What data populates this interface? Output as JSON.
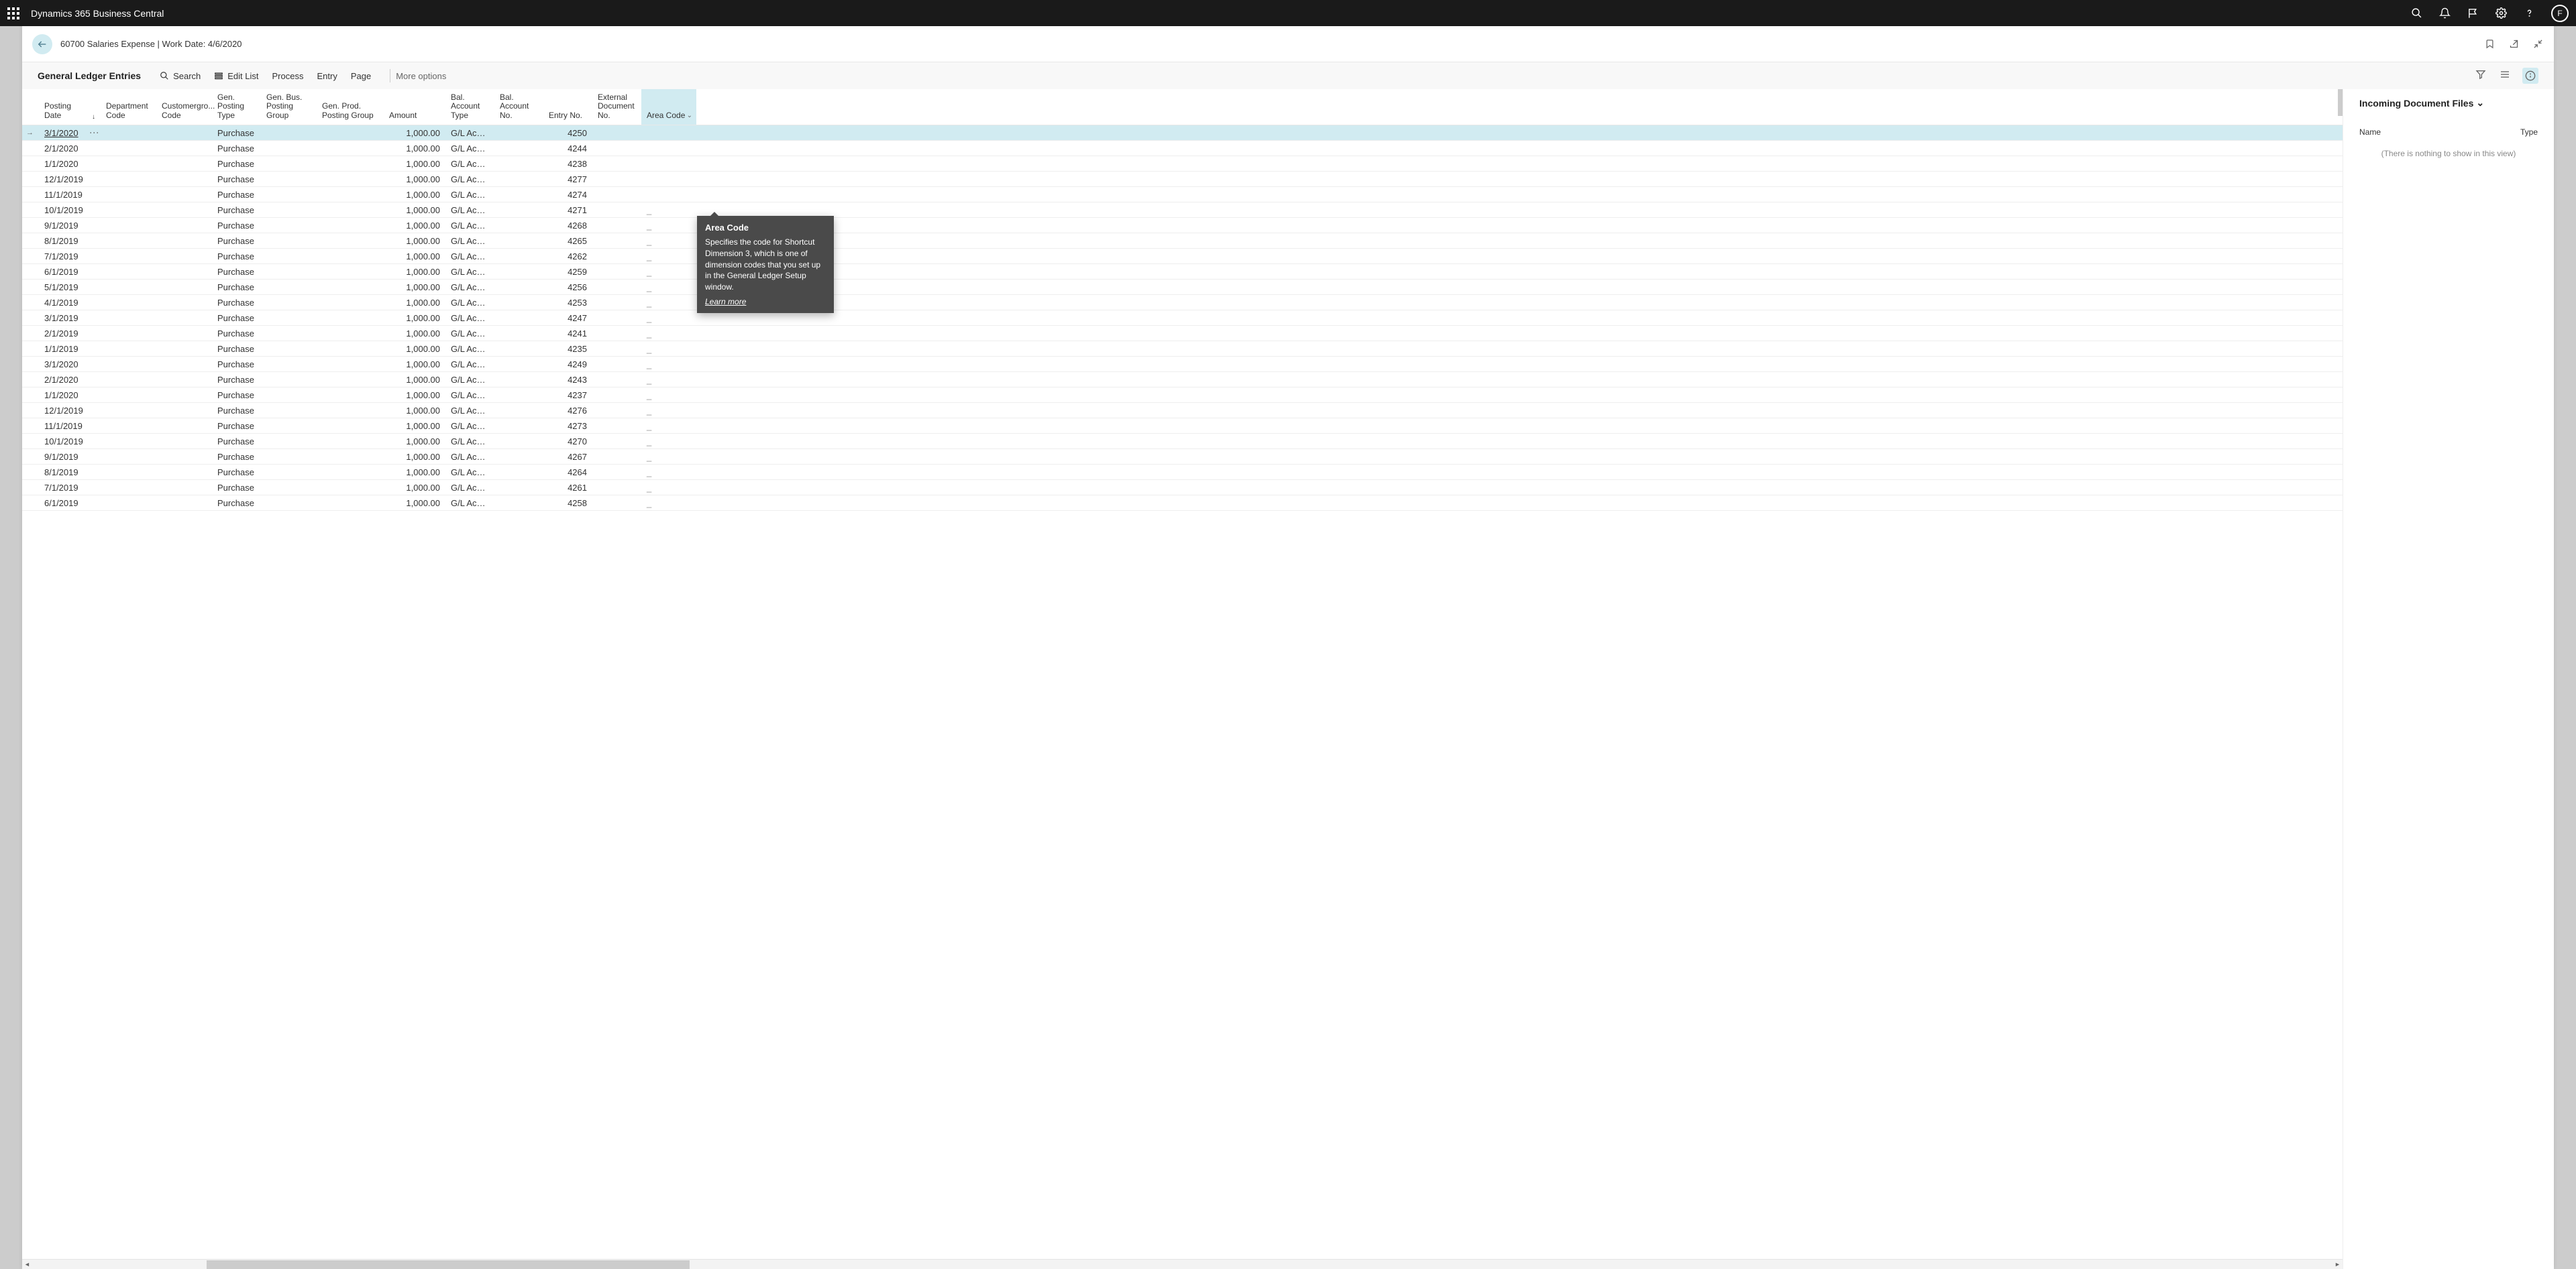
{
  "app": {
    "title": "Dynamics 365 Business Central"
  },
  "avatar": {
    "initial": "F"
  },
  "page": {
    "title": "60700 Salaries Expense | Work Date: 4/6/2020"
  },
  "toolbar": {
    "heading": "General Ledger Entries",
    "search": "Search",
    "edit": "Edit List",
    "process": "Process",
    "entry": "Entry",
    "page": "Page",
    "more": "More options"
  },
  "columns": {
    "posting_date": "Posting Date",
    "dept": "Department Code",
    "cust": "Customergro... Code",
    "gpt": "Gen. Posting Type",
    "gbp": "Gen. Bus. Posting Group",
    "gpp": "Gen. Prod. Posting Group",
    "amount": "Amount",
    "bat": "Bal. Account Type",
    "ban": "Bal. Account No.",
    "entry": "Entry No.",
    "ext": "External Document No.",
    "area": "Area Code"
  },
  "rows": [
    {
      "date": "3/1/2020",
      "gpt": "Purchase",
      "amt": "1,000.00",
      "bat": "G/L Account",
      "ent": "4250",
      "area": ""
    },
    {
      "date": "2/1/2020",
      "gpt": "Purchase",
      "amt": "1,000.00",
      "bat": "G/L Account",
      "ent": "4244",
      "area": ""
    },
    {
      "date": "1/1/2020",
      "gpt": "Purchase",
      "amt": "1,000.00",
      "bat": "G/L Account",
      "ent": "4238",
      "area": ""
    },
    {
      "date": "12/1/2019",
      "gpt": "Purchase",
      "amt": "1,000.00",
      "bat": "G/L Account",
      "ent": "4277",
      "area": ""
    },
    {
      "date": "11/1/2019",
      "gpt": "Purchase",
      "amt": "1,000.00",
      "bat": "G/L Account",
      "ent": "4274",
      "area": ""
    },
    {
      "date": "10/1/2019",
      "gpt": "Purchase",
      "amt": "1,000.00",
      "bat": "G/L Account",
      "ent": "4271",
      "area": "_"
    },
    {
      "date": "9/1/2019",
      "gpt": "Purchase",
      "amt": "1,000.00",
      "bat": "G/L Account",
      "ent": "4268",
      "area": "_"
    },
    {
      "date": "8/1/2019",
      "gpt": "Purchase",
      "amt": "1,000.00",
      "bat": "G/L Account",
      "ent": "4265",
      "area": "_"
    },
    {
      "date": "7/1/2019",
      "gpt": "Purchase",
      "amt": "1,000.00",
      "bat": "G/L Account",
      "ent": "4262",
      "area": "_"
    },
    {
      "date": "6/1/2019",
      "gpt": "Purchase",
      "amt": "1,000.00",
      "bat": "G/L Account",
      "ent": "4259",
      "area": "_"
    },
    {
      "date": "5/1/2019",
      "gpt": "Purchase",
      "amt": "1,000.00",
      "bat": "G/L Account",
      "ent": "4256",
      "area": "_"
    },
    {
      "date": "4/1/2019",
      "gpt": "Purchase",
      "amt": "1,000.00",
      "bat": "G/L Account",
      "ent": "4253",
      "area": "_"
    },
    {
      "date": "3/1/2019",
      "gpt": "Purchase",
      "amt": "1,000.00",
      "bat": "G/L Account",
      "ent": "4247",
      "area": "_"
    },
    {
      "date": "2/1/2019",
      "gpt": "Purchase",
      "amt": "1,000.00",
      "bat": "G/L Account",
      "ent": "4241",
      "area": "_"
    },
    {
      "date": "1/1/2019",
      "gpt": "Purchase",
      "amt": "1,000.00",
      "bat": "G/L Account",
      "ent": "4235",
      "area": "_"
    },
    {
      "date": "3/1/2020",
      "gpt": "Purchase",
      "amt": "1,000.00",
      "bat": "G/L Account",
      "ent": "4249",
      "area": "_"
    },
    {
      "date": "2/1/2020",
      "gpt": "Purchase",
      "amt": "1,000.00",
      "bat": "G/L Account",
      "ent": "4243",
      "area": "_"
    },
    {
      "date": "1/1/2020",
      "gpt": "Purchase",
      "amt": "1,000.00",
      "bat": "G/L Account",
      "ent": "4237",
      "area": "_"
    },
    {
      "date": "12/1/2019",
      "gpt": "Purchase",
      "amt": "1,000.00",
      "bat": "G/L Account",
      "ent": "4276",
      "area": "_"
    },
    {
      "date": "11/1/2019",
      "gpt": "Purchase",
      "amt": "1,000.00",
      "bat": "G/L Account",
      "ent": "4273",
      "area": "_"
    },
    {
      "date": "10/1/2019",
      "gpt": "Purchase",
      "amt": "1,000.00",
      "bat": "G/L Account",
      "ent": "4270",
      "area": "_"
    },
    {
      "date": "9/1/2019",
      "gpt": "Purchase",
      "amt": "1,000.00",
      "bat": "G/L Account",
      "ent": "4267",
      "area": "_"
    },
    {
      "date": "8/1/2019",
      "gpt": "Purchase",
      "amt": "1,000.00",
      "bat": "G/L Account",
      "ent": "4264",
      "area": "_"
    },
    {
      "date": "7/1/2019",
      "gpt": "Purchase",
      "amt": "1,000.00",
      "bat": "G/L Account",
      "ent": "4261",
      "area": "_"
    },
    {
      "date": "6/1/2019",
      "gpt": "Purchase",
      "amt": "1,000.00",
      "bat": "G/L Account",
      "ent": "4258",
      "area": "_"
    }
  ],
  "sidebar": {
    "title": "Incoming Document Files",
    "col_name": "Name",
    "col_type": "Type",
    "empty": "(There is nothing to show in this view)"
  },
  "tooltip": {
    "title": "Area Code",
    "body": "Specifies the code for Shortcut Dimension 3, which is one of dimension codes that you set up in the General Ledger Setup window.",
    "link": "Learn more"
  }
}
